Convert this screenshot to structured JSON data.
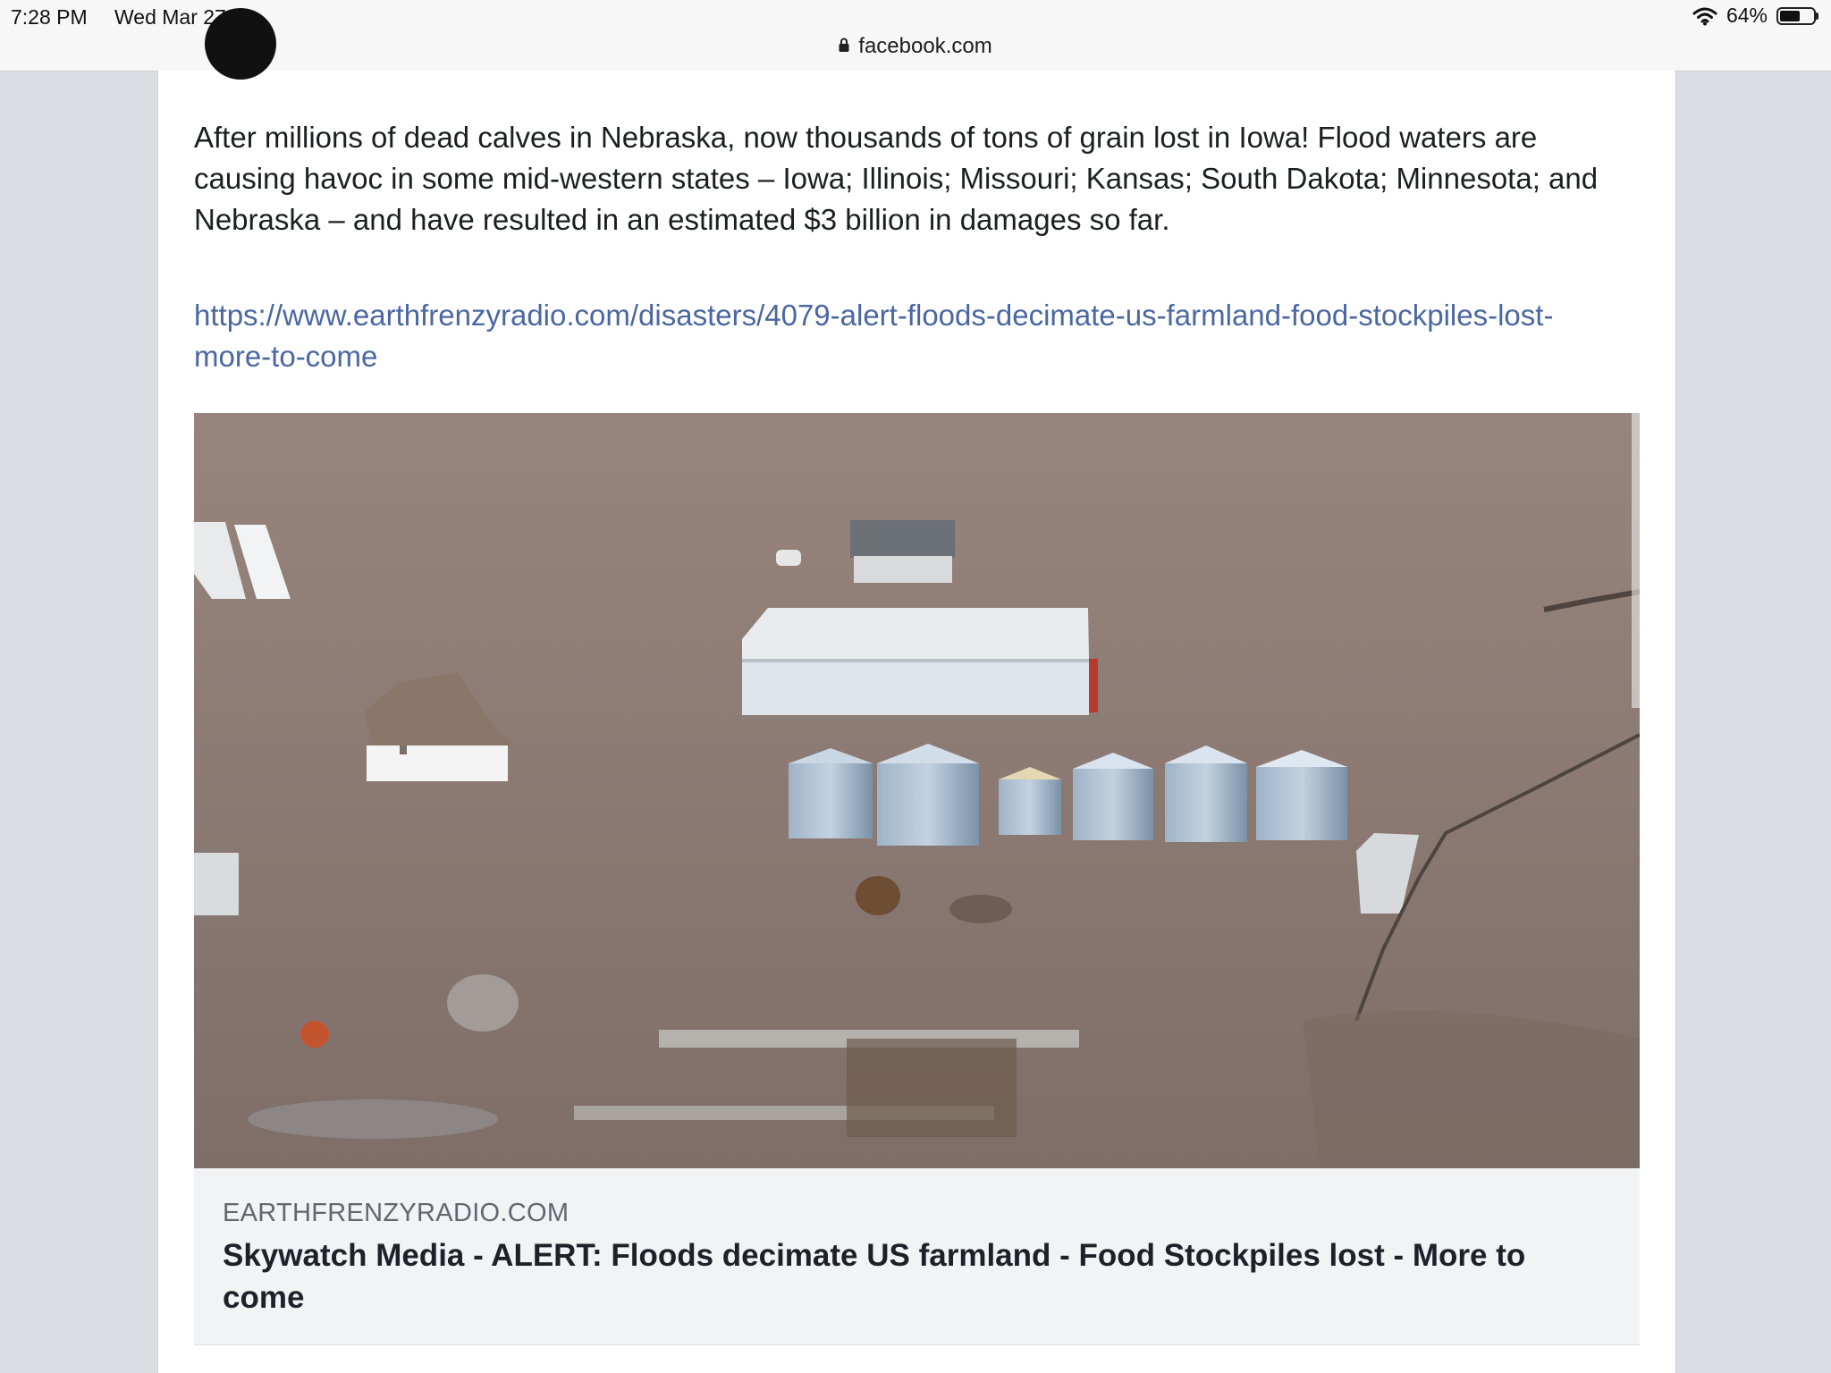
{
  "status_bar": {
    "time": "7:28 PM",
    "date": "Wed Mar 27",
    "battery_percent": "64%",
    "battery_level": 0.64,
    "wifi_icon": "wifi-icon"
  },
  "browser": {
    "url": "facebook.com",
    "lock_icon": "lock-icon"
  },
  "post": {
    "text": "After millions of dead calves in Nebraska, now thousands of tons of grain lost in Iowa! Flood waters are causing havoc in some mid-western states – Iowa; Illinois; Missouri; Kansas; South Dakota; Minnesota; and Nebraska – and have resulted in an estimated $3 billion in damages so far.",
    "link": "https://www.earthfrenzyradio.com/disasters/4079-alert-floods-decimate-us-farmland-food-stockpiles-lost-more-to-come",
    "link_color": "#4b67a1"
  },
  "link_preview": {
    "domain": "EARTHFRENZYRADIO.COM",
    "title": "Skywatch Media - ALERT: Floods decimate US farmland - Food Stockpiles lost - More to come",
    "background": "#f2f3f5"
  },
  "colors": {
    "page_bg": "#dadde1",
    "card_bg": "#ffffff",
    "flood_water": "#8d7b74"
  }
}
